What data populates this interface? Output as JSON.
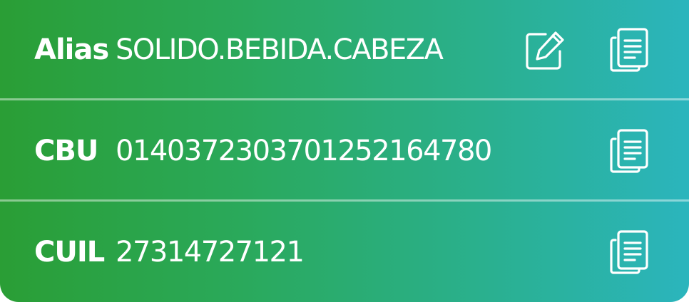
{
  "account": {
    "alias": {
      "label": "Alias",
      "value": "SOLIDO.BEBIDA.CABEZA"
    },
    "cbu": {
      "label": "CBU",
      "value": "0140372303701252164780"
    },
    "cuil": {
      "label": "CUIL",
      "value": "27314727121"
    }
  },
  "icons": {
    "edit": "pencil-square-icon",
    "copy": "copy-icon"
  },
  "colors": {
    "gradient_start": "#2a9e35",
    "gradient_end": "#2bb5bd",
    "text": "#ffffff"
  }
}
